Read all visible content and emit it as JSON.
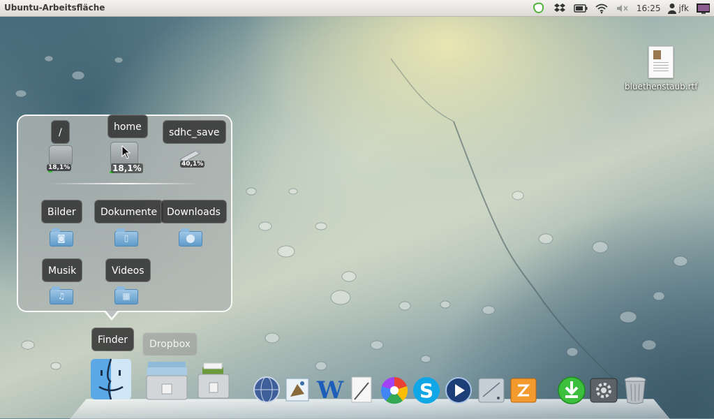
{
  "panel": {
    "title": "Ubuntu-Arbeitsfläche",
    "clock": "16:25",
    "user": "jfk"
  },
  "desktop": {
    "file_label": "bluethenstaub.rtf"
  },
  "stack": {
    "drives": [
      {
        "label": "/",
        "usage": "18,1%"
      },
      {
        "label": "home",
        "usage": "18,1%"
      },
      {
        "label": "sdhc_save",
        "usage": "40,1%"
      }
    ],
    "folders": [
      {
        "label": "Bilder",
        "icon": "camera-icon"
      },
      {
        "label": "Dokumente",
        "icon": "document-icon"
      },
      {
        "label": "Downloads",
        "icon": "download-icon"
      },
      {
        "label": "Musik",
        "icon": "music-note-icon"
      },
      {
        "label": "Videos",
        "icon": "film-icon"
      }
    ]
  },
  "dock": {
    "finder_tooltip": "Finder",
    "dropbox_tooltip": "Dropbox",
    "items": [
      "finder-icon",
      "files-stack-icon",
      "archive-icon",
      "browser-globe-icon",
      "mail-icon",
      "word-processor-icon",
      "text-editor-icon",
      "picasa-icon",
      "skype-icon",
      "media-player-icon",
      "disk-utility-icon",
      "archive-manager-icon",
      "download-manager-icon",
      "system-preferences-icon",
      "trash-icon"
    ]
  },
  "colors": {
    "panel_bg": "#dcdad5",
    "tooltip_bg": "#343434",
    "folder_blue": "#5f9bc8",
    "usage_green": "#3cc33c"
  }
}
